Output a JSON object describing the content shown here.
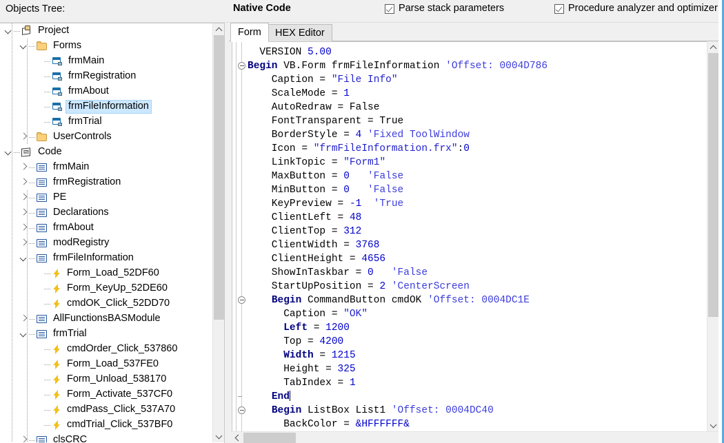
{
  "header": {
    "objects_tree_label": "Objects Tree:",
    "native_code_label": "Native Code",
    "checkboxes": [
      {
        "label": "Parse stack parameters",
        "checked": true,
        "icon": "checkbox-checked-icon"
      },
      {
        "label": "Procedure analyzer and optimizer",
        "checked": true,
        "icon": "checkbox-checked-icon"
      }
    ]
  },
  "tree": {
    "nodes": [
      {
        "label": "Project",
        "depth": 0,
        "icon": "project-icon",
        "expander": "open",
        "selected": false
      },
      {
        "label": "Forms",
        "depth": 1,
        "icon": "folder-icon",
        "expander": "open",
        "selected": false
      },
      {
        "label": "frmMain",
        "depth": 2,
        "icon": "form-icon",
        "expander": "none",
        "selected": false
      },
      {
        "label": "frmRegistration",
        "depth": 2,
        "icon": "form-icon",
        "expander": "none",
        "selected": false
      },
      {
        "label": "frmAbout",
        "depth": 2,
        "icon": "form-icon",
        "expander": "none",
        "selected": false
      },
      {
        "label": "frmFileInformation",
        "depth": 2,
        "icon": "form-icon",
        "expander": "none",
        "selected": true
      },
      {
        "label": "frmTrial",
        "depth": 2,
        "icon": "form-icon",
        "expander": "none",
        "selected": false
      },
      {
        "label": "UserControls",
        "depth": 1,
        "icon": "folder-icon",
        "expander": "closed",
        "selected": false
      },
      {
        "label": "Code",
        "depth": 0,
        "icon": "code-root-icon",
        "expander": "open",
        "selected": false
      },
      {
        "label": "frmMain",
        "depth": 1,
        "icon": "module-icon",
        "expander": "closed",
        "selected": false
      },
      {
        "label": "frmRegistration",
        "depth": 1,
        "icon": "module-icon",
        "expander": "closed",
        "selected": false
      },
      {
        "label": "PE",
        "depth": 1,
        "icon": "module-icon",
        "expander": "closed",
        "selected": false
      },
      {
        "label": "Declarations",
        "depth": 1,
        "icon": "module-icon",
        "expander": "closed",
        "selected": false
      },
      {
        "label": "frmAbout",
        "depth": 1,
        "icon": "module-icon",
        "expander": "closed",
        "selected": false
      },
      {
        "label": "modRegistry",
        "depth": 1,
        "icon": "module-icon",
        "expander": "closed",
        "selected": false
      },
      {
        "label": "frmFileInformation",
        "depth": 1,
        "icon": "module-icon",
        "expander": "open",
        "selected": false
      },
      {
        "label": "Form_Load_52DF60",
        "depth": 2,
        "icon": "procedure-icon",
        "expander": "none",
        "selected": false
      },
      {
        "label": "Form_KeyUp_52DE60",
        "depth": 2,
        "icon": "procedure-icon",
        "expander": "none",
        "selected": false
      },
      {
        "label": "cmdOK_Click_52DD70",
        "depth": 2,
        "icon": "procedure-icon",
        "expander": "none",
        "selected": false
      },
      {
        "label": "AllFunctionsBASModule",
        "depth": 1,
        "icon": "module-icon",
        "expander": "closed",
        "selected": false
      },
      {
        "label": "frmTrial",
        "depth": 1,
        "icon": "module-icon",
        "expander": "open",
        "selected": false
      },
      {
        "label": "cmdOrder_Click_537860",
        "depth": 2,
        "icon": "procedure-icon",
        "expander": "none",
        "selected": false
      },
      {
        "label": "Form_Load_537FE0",
        "depth": 2,
        "icon": "procedure-icon",
        "expander": "none",
        "selected": false
      },
      {
        "label": "Form_Unload_538170",
        "depth": 2,
        "icon": "procedure-icon",
        "expander": "none",
        "selected": false
      },
      {
        "label": "Form_Activate_537CF0",
        "depth": 2,
        "icon": "procedure-icon",
        "expander": "none",
        "selected": false
      },
      {
        "label": "cmdPass_Click_537A70",
        "depth": 2,
        "icon": "procedure-icon",
        "expander": "none",
        "selected": false
      },
      {
        "label": "cmdTrial_Click_537BF0",
        "depth": 2,
        "icon": "procedure-icon",
        "expander": "none",
        "selected": false
      },
      {
        "label": "clsCRC",
        "depth": 1,
        "icon": "module-icon",
        "expander": "closed",
        "selected": false
      }
    ]
  },
  "editor": {
    "tabs": [
      {
        "label": "Form",
        "active": true
      },
      {
        "label": "HEX Editor",
        "active": false
      }
    ],
    "lines": [
      {
        "fold": "none",
        "segments": [
          {
            "t": "  VERSION ",
            "c": "plain"
          },
          {
            "t": "5.00",
            "c": "num"
          }
        ]
      },
      {
        "fold": "minus",
        "segments": [
          {
            "t": "Begin",
            "c": "kw"
          },
          {
            "t": " VB.Form frmFileInformation ",
            "c": "plain"
          },
          {
            "t": "'Offset: 0004D786",
            "c": "com"
          }
        ]
      },
      {
        "fold": "none",
        "segments": [
          {
            "t": "    Caption = ",
            "c": "plain"
          },
          {
            "t": "\"File Info\"",
            "c": "str"
          }
        ]
      },
      {
        "fold": "none",
        "segments": [
          {
            "t": "    ScaleMode = ",
            "c": "plain"
          },
          {
            "t": "1",
            "c": "num"
          }
        ]
      },
      {
        "fold": "none",
        "segments": [
          {
            "t": "    AutoRedraw = False",
            "c": "plain"
          }
        ]
      },
      {
        "fold": "none",
        "segments": [
          {
            "t": "    FontTransparent = True",
            "c": "plain"
          }
        ]
      },
      {
        "fold": "none",
        "segments": [
          {
            "t": "    BorderStyle = ",
            "c": "plain"
          },
          {
            "t": "4",
            "c": "num"
          },
          {
            "t": " ",
            "c": "plain"
          },
          {
            "t": "'Fixed ToolWindow",
            "c": "com"
          }
        ]
      },
      {
        "fold": "none",
        "segments": [
          {
            "t": "    Icon = ",
            "c": "plain"
          },
          {
            "t": "\"frmFileInformation.frx\"",
            "c": "str"
          },
          {
            "t": ":",
            "c": "plain"
          },
          {
            "t": "0",
            "c": "num"
          }
        ]
      },
      {
        "fold": "none",
        "segments": [
          {
            "t": "    LinkTopic = ",
            "c": "plain"
          },
          {
            "t": "\"Form1\"",
            "c": "str"
          }
        ]
      },
      {
        "fold": "none",
        "segments": [
          {
            "t": "    MaxButton = ",
            "c": "plain"
          },
          {
            "t": "0",
            "c": "num"
          },
          {
            "t": "   ",
            "c": "plain"
          },
          {
            "t": "'False",
            "c": "com"
          }
        ]
      },
      {
        "fold": "none",
        "segments": [
          {
            "t": "    MinButton = ",
            "c": "plain"
          },
          {
            "t": "0",
            "c": "num"
          },
          {
            "t": "   ",
            "c": "plain"
          },
          {
            "t": "'False",
            "c": "com"
          }
        ]
      },
      {
        "fold": "none",
        "segments": [
          {
            "t": "    KeyPreview = ",
            "c": "plain"
          },
          {
            "t": "-1",
            "c": "num"
          },
          {
            "t": "  ",
            "c": "plain"
          },
          {
            "t": "'True",
            "c": "com"
          }
        ]
      },
      {
        "fold": "none",
        "segments": [
          {
            "t": "    ClientLeft = ",
            "c": "plain"
          },
          {
            "t": "48",
            "c": "num"
          }
        ]
      },
      {
        "fold": "none",
        "segments": [
          {
            "t": "    ClientTop = ",
            "c": "plain"
          },
          {
            "t": "312",
            "c": "num"
          }
        ]
      },
      {
        "fold": "none",
        "segments": [
          {
            "t": "    ClientWidth = ",
            "c": "plain"
          },
          {
            "t": "3768",
            "c": "num"
          }
        ]
      },
      {
        "fold": "none",
        "segments": [
          {
            "t": "    ClientHeight = ",
            "c": "plain"
          },
          {
            "t": "4656",
            "c": "num"
          }
        ]
      },
      {
        "fold": "none",
        "segments": [
          {
            "t": "    ShowInTaskbar = ",
            "c": "plain"
          },
          {
            "t": "0",
            "c": "num"
          },
          {
            "t": "   ",
            "c": "plain"
          },
          {
            "t": "'False",
            "c": "com"
          }
        ]
      },
      {
        "fold": "none",
        "segments": [
          {
            "t": "    StartUpPosition = ",
            "c": "plain"
          },
          {
            "t": "2",
            "c": "num"
          },
          {
            "t": " ",
            "c": "plain"
          },
          {
            "t": "'CenterScreen",
            "c": "com"
          }
        ]
      },
      {
        "fold": "minus",
        "segments": [
          {
            "t": "    ",
            "c": "plain"
          },
          {
            "t": "Begin",
            "c": "kw"
          },
          {
            "t": " CommandButton cmdOK ",
            "c": "plain"
          },
          {
            "t": "'Offset: 0004DC1E",
            "c": "com"
          }
        ]
      },
      {
        "fold": "none",
        "segments": [
          {
            "t": "      Caption = ",
            "c": "plain"
          },
          {
            "t": "\"OK\"",
            "c": "str"
          }
        ]
      },
      {
        "fold": "none",
        "segments": [
          {
            "t": "      ",
            "c": "plain"
          },
          {
            "t": "Left",
            "c": "kw"
          },
          {
            "t": " = ",
            "c": "plain"
          },
          {
            "t": "1200",
            "c": "num"
          }
        ]
      },
      {
        "fold": "none",
        "segments": [
          {
            "t": "      Top = ",
            "c": "plain"
          },
          {
            "t": "4200",
            "c": "num"
          }
        ]
      },
      {
        "fold": "none",
        "segments": [
          {
            "t": "      ",
            "c": "plain"
          },
          {
            "t": "Width",
            "c": "kw"
          },
          {
            "t": " = ",
            "c": "plain"
          },
          {
            "t": "1215",
            "c": "num"
          }
        ]
      },
      {
        "fold": "none",
        "segments": [
          {
            "t": "      Height = ",
            "c": "plain"
          },
          {
            "t": "325",
            "c": "num"
          }
        ]
      },
      {
        "fold": "none",
        "segments": [
          {
            "t": "      TabIndex = ",
            "c": "plain"
          },
          {
            "t": "1",
            "c": "num"
          }
        ]
      },
      {
        "fold": "tick",
        "segments": [
          {
            "t": "    ",
            "c": "plain"
          },
          {
            "t": "End",
            "c": "kw"
          },
          {
            "t": "|caret|",
            "c": "caret"
          }
        ]
      },
      {
        "fold": "minus",
        "segments": [
          {
            "t": "    ",
            "c": "plain"
          },
          {
            "t": "Begin",
            "c": "kw"
          },
          {
            "t": " ListBox List1 ",
            "c": "plain"
          },
          {
            "t": "'Offset: 0004DC40",
            "c": "com"
          }
        ]
      },
      {
        "fold": "none",
        "segments": [
          {
            "t": "      BackColor = ",
            "c": "plain"
          },
          {
            "t": "&HFFFFFF&",
            "c": "num"
          }
        ]
      }
    ]
  },
  "scrollbars": {
    "tree_vertical": {
      "thumb_top_pct": 0,
      "thumb_height_pct": 72
    },
    "editor_vertical": {
      "thumb_top_pct": 0,
      "thumb_height_pct": 72
    },
    "editor_horizontal": {
      "thumb_left_pct": 0,
      "thumb_width_pct": 11
    }
  },
  "colors": {
    "chrome": "#f0f0f0",
    "selection": "#cce8ff",
    "keyword": "#000080",
    "literal": "#0000cc",
    "comment": "#3c3cdc",
    "accent_edge": "#5aa9e0"
  }
}
